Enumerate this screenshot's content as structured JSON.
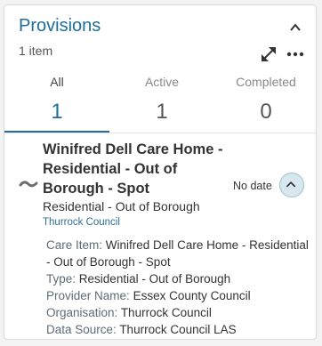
{
  "panel": {
    "title": "Provisions",
    "count_label": "1 item"
  },
  "tabs": [
    {
      "label": "All",
      "count": "1",
      "active": true
    },
    {
      "label": "Active",
      "count": "1",
      "active": false
    },
    {
      "label": "Completed",
      "count": "0",
      "active": false
    }
  ],
  "provision": {
    "name": "Winifred Dell Care Home - Residential - Out of Borough - Spot",
    "type": "Residential - Out of Borough",
    "organisation": "Thurrock Council",
    "date": "No date",
    "details": [
      {
        "key": "Care Item:",
        "value": "Winifred Dell Care Home - Residential - Out of Borough - Spot"
      },
      {
        "key": "Type:",
        "value": "Residential - Out of Borough"
      },
      {
        "key": "Provider Name:",
        "value": "Essex County Council"
      },
      {
        "key": "Organisation:",
        "value": "Thurrock Council"
      },
      {
        "key": "Data Source:",
        "value": "Thurrock Council LAS"
      }
    ]
  },
  "colors": {
    "accent": "#1f6d99",
    "toggle_bg": "#d7e6ef"
  },
  "icons": {
    "collapse": "chevron-up-icon",
    "expand": "expand-arrows-icon",
    "more": "more-dots-icon",
    "provision": "worm-icon",
    "toggle": "chevron-up-icon"
  }
}
